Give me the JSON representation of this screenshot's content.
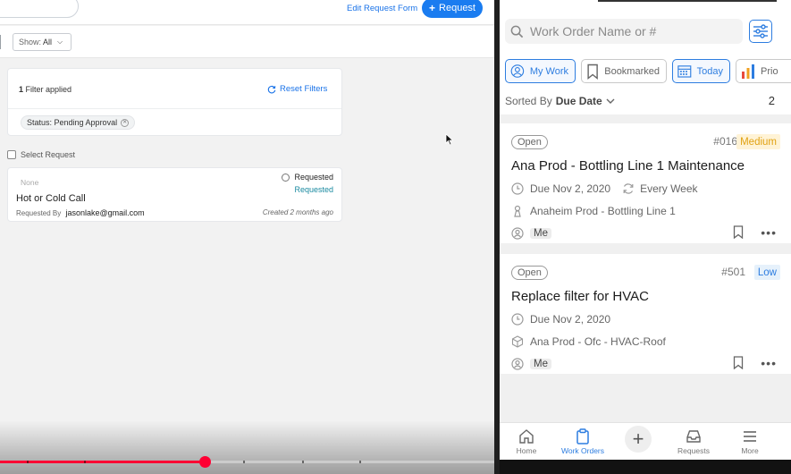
{
  "web": {
    "header": {
      "edit_form_link": "Edit Request Form",
      "new_request_plus": "+",
      "new_request_label": "Request"
    },
    "toolbar": {
      "show_prefix": "Show:",
      "show_value": "All"
    },
    "filters": {
      "count": "1",
      "applied_text": "Filter applied",
      "reset_label": "Reset Filters",
      "chips": [
        {
          "label": "Status: Pending Approval"
        }
      ]
    },
    "select_label": "Select Request",
    "requests": [
      {
        "tag": "None",
        "title": "Hot or Cold Call",
        "requested_by_label": "Requested By",
        "requested_by": "jasonlake@gmail.com",
        "status_option": "Requested",
        "status_text": "Requested",
        "created": "Created 2 months ago"
      }
    ],
    "video_progress": 0.415
  },
  "mobile": {
    "search_placeholder": "Work Order Name or #",
    "tabs": [
      {
        "label": "My Work",
        "icon": "user-circle-icon",
        "active": true
      },
      {
        "label": "Bookmarked",
        "icon": "bookmark-icon",
        "active": false
      },
      {
        "label": "Today",
        "icon": "calendar-icon",
        "active": true
      },
      {
        "label": "Prio",
        "icon": "bar-chart-icon",
        "active": false
      }
    ],
    "sort_prefix": "Sorted By",
    "sort_value": "Due Date",
    "count": "2",
    "work_orders": [
      {
        "status": "Open",
        "number": "#016",
        "priority": "Medium",
        "title": "Ana Prod - Bottling Line 1 Maintenance",
        "due": "Due Nov 2, 2020",
        "repeat": "Every Week",
        "location": "Anaheim Prod - Bottling Line 1",
        "assignee": "Me"
      },
      {
        "status": "Open",
        "number": "#501",
        "priority": "Low",
        "title": "Replace filter for HVAC",
        "due": "Due Nov 2, 2020",
        "location": "Ana Prod - Ofc - HVAC-Roof",
        "assignee": "Me"
      }
    ],
    "nav": {
      "home": "Home",
      "work_orders": "Work Orders",
      "requests": "Requests",
      "more": "More"
    }
  },
  "colors": {
    "accent": "#1a7cf0",
    "medium_priority": "#e1a213",
    "low_priority": "#2d7de0",
    "progress": "#ff0033"
  }
}
